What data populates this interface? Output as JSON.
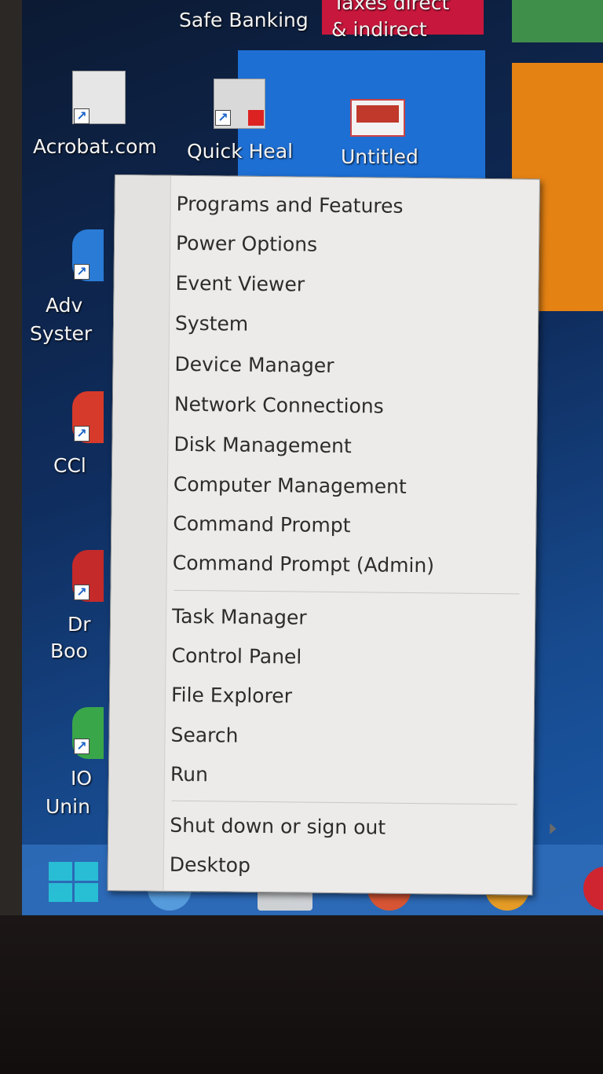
{
  "tiles": {
    "safe_banking": "Safe Banking",
    "taxes_line1": "Taxes direct",
    "taxes_line2": "& indirect",
    "untitled": "Untitled"
  },
  "desktop_icons": [
    {
      "label": "Acrobat.com"
    },
    {
      "label": "Quick Heal"
    },
    {
      "label": "Adv"
    },
    {
      "label": "Syster"
    },
    {
      "label": "CCl"
    },
    {
      "label": "Dr"
    },
    {
      "label": "Boo"
    },
    {
      "label": "IO"
    },
    {
      "label": "Unin"
    }
  ],
  "menu": {
    "items": [
      {
        "label": "Programs and Features"
      },
      {
        "label": "Power Options"
      },
      {
        "label": "Event Viewer"
      },
      {
        "label": "System"
      },
      {
        "label": "Device Manager"
      },
      {
        "label": "Network Connections"
      },
      {
        "label": "Disk Management"
      },
      {
        "label": "Computer Management"
      },
      {
        "label": "Command Prompt"
      },
      {
        "label": "Command Prompt (Admin)"
      },
      {
        "label": "Task Manager"
      },
      {
        "label": "Control Panel"
      },
      {
        "label": "File Explorer"
      },
      {
        "label": "Search"
      },
      {
        "label": "Run"
      },
      {
        "label": "Shut down or sign out"
      },
      {
        "label": "Desktop"
      }
    ]
  },
  "colors": {
    "menu_bg": "#ecebe9",
    "tile_blue": "#1d6fd4",
    "tile_orange": "#e58214",
    "tile_red": "#c8173c",
    "tile_green": "#3f8f4a",
    "start_accent": "#29c4d8"
  }
}
